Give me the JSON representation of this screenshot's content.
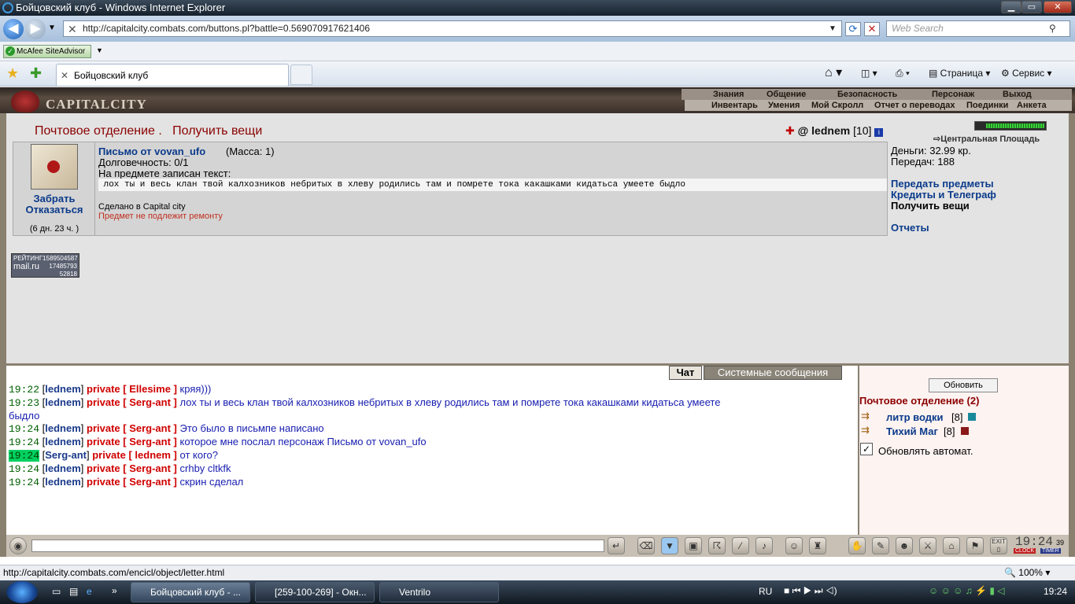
{
  "window": {
    "title": "Бойцовский клуб - Windows Internet Explorer",
    "min": "▁",
    "max": "▭",
    "close": "✕"
  },
  "browser": {
    "url": "http://capitalcity.combats.com/buttons.pl?battle=0.569070917621406",
    "search_placeholder": "Web Search",
    "mcafee": "McAfee SiteAdvisor",
    "tab_title": "Бойцовский клуб",
    "toolbar": {
      "page": "Страница",
      "tools": "Сервис"
    },
    "status_url": "http://capitalcity.combats.com/encicl/object/letter.html",
    "zoom": "100%"
  },
  "game": {
    "logo": "CAPITALCITY",
    "nav_top": [
      "Знания",
      "Общение",
      "Безопасность",
      "Персонаж",
      "Выход"
    ],
    "nav_bottom": [
      "Инвентарь",
      "Умения",
      "Мой Скролл",
      "Отчет о переводах",
      "Поединки",
      "Анкета"
    ],
    "page_header": "Почтовое отделение .   Получить вещи",
    "user": {
      "name": "lednem",
      "level": "[10]"
    },
    "item": {
      "take": "Забрать",
      "decline": "Отказаться",
      "time": "(6 дн. 23 ч. )",
      "name": "Письмо от vovan_ufo",
      "mass": "(Масса: 1)",
      "durability": "Долговечность: 0/1",
      "text_label": "На предмете записан текст:",
      "text": " лох ты и весь клан твой калхозников небритых в хлеву родились там и помрете тока какашками кидатьса умеете быдло",
      "made_in": "Сделано в Capital city",
      "repair": "Предмет не подлежит ремонту"
    },
    "rating": {
      "label": "РЕЙТИНГ",
      "n1": "1589504587",
      "n2": "17485793",
      "n3": "52818",
      "brand": "mail.ru"
    },
    "right": {
      "location": "Центральная Площадь",
      "money": "Деньги: 32.99 кр.",
      "transfers": "Передач: 188",
      "links": [
        "Передать предметы",
        "Кредиты и Телеграф"
      ],
      "current": "Получить вещи",
      "reports": "Отчеты"
    },
    "chat_tabs": [
      "Чат",
      "Системные сообщения"
    ],
    "chat": [
      {
        "time": "19:22",
        "from": "lednem",
        "to": "Ellesime",
        "text": "кряя)))",
        "hl": false
      },
      {
        "time": "19:23",
        "from": "lednem",
        "to": "Serg-ant",
        "text": "лох ты и весь клан твой калхозников небритых в хлеву родились там и помрете тока какашками кидатьса умеете",
        "cont": "быдло",
        "hl": false
      },
      {
        "time": "19:24",
        "from": "lednem",
        "to": "Serg-ant",
        "text": "Это было в письмпе написано",
        "hl": false
      },
      {
        "time": "19:24",
        "from": "lednem",
        "to": "Serg-ant",
        "text": "которое мне послал персонаж Письмо от vovan_ufo",
        "hl": false
      },
      {
        "time": "19:24",
        "from": "Serg-ant",
        "to": "lednem",
        "text": "от кого?",
        "hl": true
      },
      {
        "time": "19:24",
        "from": "lednem",
        "to": "Serg-ant",
        "text": "crhby cltkfk",
        "hl": false
      },
      {
        "time": "19:24",
        "from": "lednem",
        "to": "Serg-ant",
        "text": "скрин сделал",
        "hl": false
      }
    ],
    "private_label": "private",
    "sidebar": {
      "refresh": "Обновить",
      "title": "Почтовое отделение (2)",
      "users": [
        {
          "name": "литр водки",
          "level": "[8]"
        },
        {
          "name": "Тихий Маг",
          "level": "[8]"
        }
      ],
      "auto": "Обновлять автомат."
    },
    "clock": {
      "time": "19:24",
      "sec": "39",
      "l1": "CLOCK",
      "l2": "TIMER",
      "exit": "EXIT"
    }
  },
  "taskbar": {
    "items": [
      "Бойцовский клуб - ...",
      "[259-100-269] - Окн...",
      "Ventrilo"
    ],
    "lang": "RU",
    "time": "19:24"
  }
}
